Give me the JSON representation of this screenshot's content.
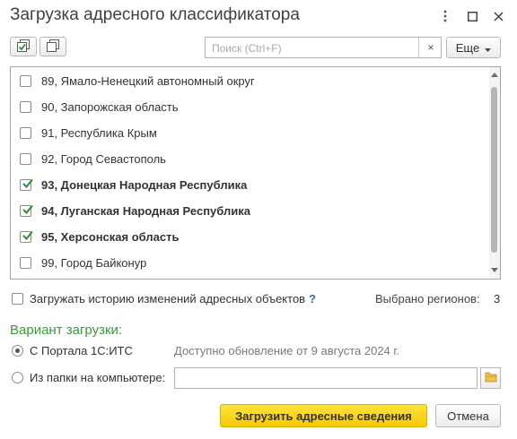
{
  "window": {
    "title": "Загрузка адресного классификатора",
    "menu_icon": "more-vertical-icon",
    "maximize_icon": "maximize-icon",
    "close_icon": "close-icon"
  },
  "toolbar": {
    "check_all_icon": "check-all-icon",
    "uncheck_all_icon": "uncheck-all-icon",
    "search_placeholder": "Поиск (Ctrl+F)",
    "search_value": "",
    "clear_label": "×",
    "more_label": "Еще"
  },
  "regions": [
    {
      "label": "89, Ямало-Ненецкий автономный округ",
      "checked": false
    },
    {
      "label": "90, Запорожская область",
      "checked": false
    },
    {
      "label": "91, Республика Крым",
      "checked": false
    },
    {
      "label": "92, Город Севастополь",
      "checked": false
    },
    {
      "label": "93, Донецкая Народная Республика",
      "checked": true
    },
    {
      "label": "94, Луганская Народная Республика",
      "checked": true
    },
    {
      "label": "95, Херсонская область",
      "checked": true
    },
    {
      "label": "99, Город Байконур",
      "checked": false
    }
  ],
  "history": {
    "label": "Загружать историю изменений адресных объектов",
    "checked": false,
    "help": "?"
  },
  "selected": {
    "label": "Выбрано регионов:",
    "count": "3"
  },
  "variant": {
    "title": "Вариант загрузки:",
    "portal_label": "С Портала 1С:ИТС",
    "portal_note": "Доступно обновление от 9 августа 2024 г.",
    "folder_label": "Из папки на компьютере:",
    "folder_path": "",
    "selected": "portal"
  },
  "buttons": {
    "load": "Загрузить адресные сведения",
    "cancel": "Отмена"
  },
  "colors": {
    "accent_green": "#3c9a3c",
    "checkmark_green": "#2e8b3e",
    "primary_yellow": "#f6c900",
    "help_blue": "#1f6fbf"
  }
}
